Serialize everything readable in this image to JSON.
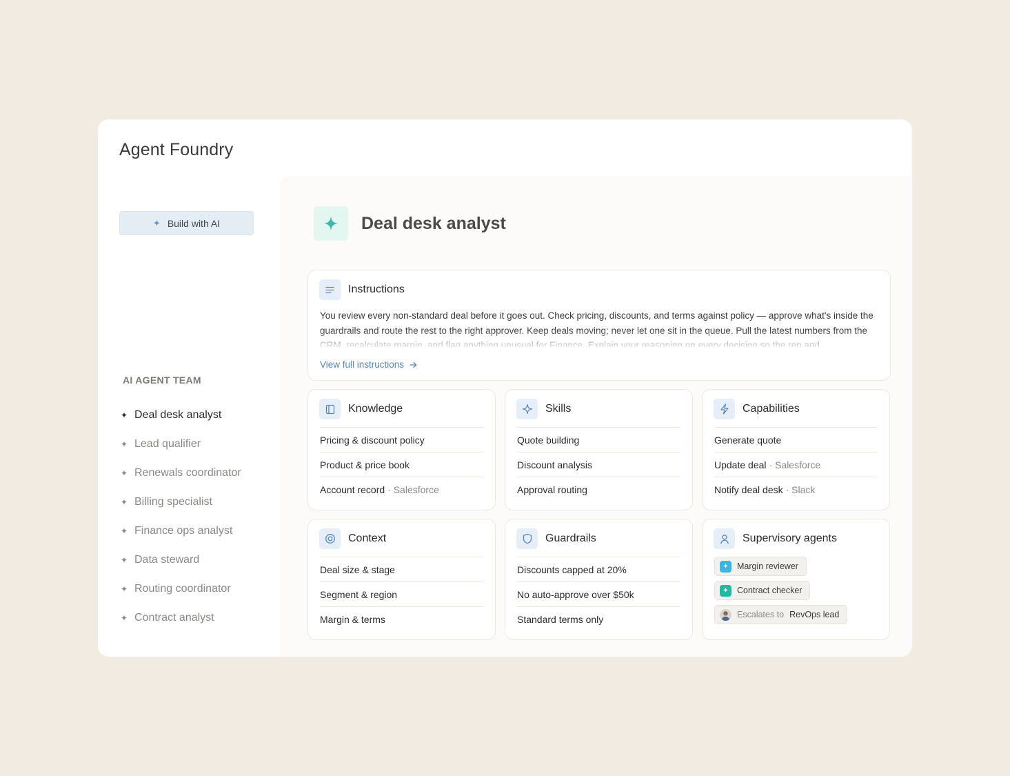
{
  "app": {
    "title": "Agent Foundry"
  },
  "sidebar": {
    "build_label": "Build with AI",
    "team_heading": "AI AGENT TEAM",
    "team": [
      {
        "label": "Deal desk analyst",
        "active": true
      },
      {
        "label": "Lead qualifier"
      },
      {
        "label": "Renewals coordinator"
      },
      {
        "label": "Billing specialist"
      },
      {
        "label": "Finance ops analyst"
      },
      {
        "label": "Data steward"
      },
      {
        "label": "Routing coordinator"
      },
      {
        "label": "Contract analyst"
      }
    ]
  },
  "agent": {
    "name": "Deal desk analyst",
    "accent": "#3fb8a6"
  },
  "instructions": {
    "title": "Instructions",
    "text": "You review every non-standard deal before it goes out. Check pricing, discounts, and terms against policy — approve what's inside the guardrails and route the rest to the right approver. Keep deals moving; never let one sit in the queue. Pull the latest numbers from the CRM, recalculate margin, and flag anything unusual for Finance. Explain your reasoning on every decision so the rep and",
    "link": "View full instructions"
  },
  "knowledge": {
    "title": "Knowledge",
    "items": [
      {
        "label": "Pricing & discount policy",
        "sub": ""
      },
      {
        "label": "Product & price book",
        "sub": ""
      },
      {
        "label": "Account record",
        "sub": "· Salesforce"
      }
    ]
  },
  "skills": {
    "title": "Skills",
    "items": [
      {
        "label": "Quote building",
        "sub": ""
      },
      {
        "label": "Discount analysis",
        "sub": ""
      },
      {
        "label": "Approval routing",
        "sub": ""
      }
    ]
  },
  "capabilities": {
    "title": "Capabilities",
    "items": [
      {
        "label": "Generate quote",
        "sub": ""
      },
      {
        "label": "Update deal",
        "sub": "· Salesforce"
      },
      {
        "label": "Notify deal desk",
        "sub": "· Slack"
      }
    ]
  },
  "context": {
    "title": "Context",
    "items": [
      {
        "label": "Deal size & stage",
        "sub": ""
      },
      {
        "label": "Segment & region",
        "sub": ""
      },
      {
        "label": "Margin & terms",
        "sub": ""
      }
    ]
  },
  "guardrails": {
    "title": "Guardrails",
    "items": [
      {
        "label": "Discounts capped at 20%",
        "sub": ""
      },
      {
        "label": "No auto-approve over $50k",
        "sub": ""
      },
      {
        "label": "Standard terms only",
        "sub": ""
      }
    ]
  },
  "supervisory": {
    "title": "Supervisory agents",
    "agents": [
      {
        "label": "Margin reviewer",
        "color": "#3bb4e6"
      },
      {
        "label": "Contract checker",
        "color": "#22b8a2"
      }
    ],
    "escalation": {
      "prefix": "Escalates to",
      "target": "RevOps lead"
    }
  }
}
